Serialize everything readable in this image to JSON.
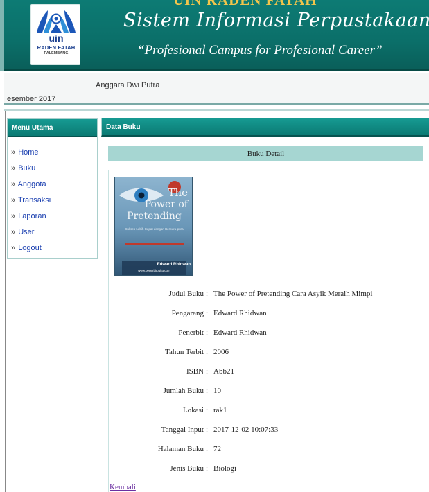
{
  "header": {
    "logo": {
      "uin": "uin",
      "name": "RADEN FATAH",
      "city": "PALEMBANG"
    },
    "top_cut_text": "UIN RADEN FATAH",
    "title": "Sistem Informasi Perpustakaan",
    "tagline": "“Profesional Campus for Profesional Career”",
    "colors": {
      "banner": "#0b6f69",
      "title_text": "#ffffff"
    }
  },
  "user_strip": {
    "user_name": "Anggara Dwi Putra",
    "date": "esember 2017"
  },
  "sidebar": {
    "title": "Menu Utama",
    "items": [
      {
        "label": "Home"
      },
      {
        "label": "Buku"
      },
      {
        "label": "Anggota"
      },
      {
        "label": "Transaksi"
      },
      {
        "label": "Laporan"
      },
      {
        "label": "User"
      },
      {
        "label": "Logout"
      }
    ],
    "arrow": "»"
  },
  "main": {
    "title": "Data Buku",
    "detail_title": "Buku Detail",
    "cover": {
      "title_lines": [
        "The",
        "Power of",
        "Pretending"
      ],
      "subtitle": "Sukses Lebih Cepat dengan Berpura-pura",
      "author": "Edward Rhidwan",
      "site": "www.penerbitbuku.com"
    },
    "fields": [
      {
        "label": "Judul Buku",
        "value": "The Power of Pretending Cara Asyik Meraih Mimpi"
      },
      {
        "label": "Pengarang",
        "value": "Edward Rhidwan"
      },
      {
        "label": "Penerbit",
        "value": "Edward Rhidwan"
      },
      {
        "label": "Tahun Terbit",
        "value": "2006"
      },
      {
        "label": "ISBN",
        "value": "Abb21"
      },
      {
        "label": "Jumlah Buku",
        "value": "10"
      },
      {
        "label": "Lokasi",
        "value": "rak1"
      },
      {
        "label": "Tanggal Input",
        "value": "2017-12-02 10:07:33"
      },
      {
        "label": "Halaman Buku",
        "value": "72"
      },
      {
        "label": "Jenis Buku",
        "value": "Biologi"
      }
    ],
    "colon": ":",
    "back_link": "Kembali"
  }
}
